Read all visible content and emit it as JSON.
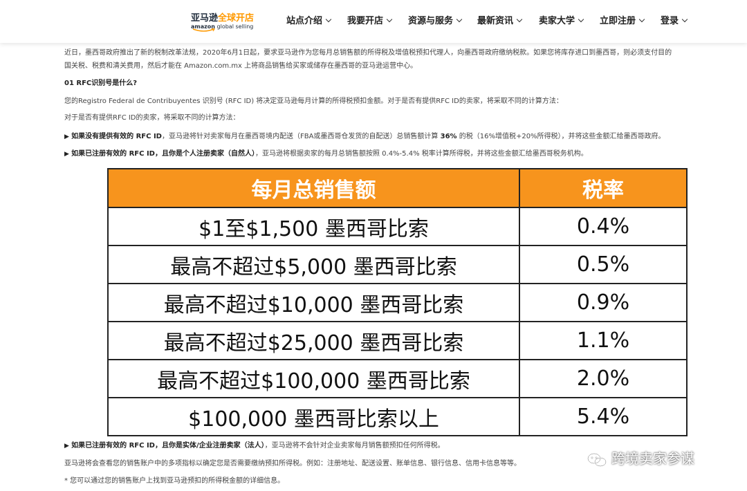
{
  "logo": {
    "cn_main": "亚马逊",
    "cn_accent": "全球开店",
    "brand": "amazon",
    "sub": "global selling"
  },
  "nav": {
    "items": [
      {
        "label": "站点介绍"
      },
      {
        "label": "我要开店"
      },
      {
        "label": "资源与服务"
      },
      {
        "label": "最新资讯"
      },
      {
        "label": "卖家大学"
      },
      {
        "label": "立即注册"
      },
      {
        "label": "登录"
      }
    ]
  },
  "article": {
    "intro_line1": "近日，墨西哥政府推出了新的税制改革法规，2020年6月1日起，要求亚马逊作为您每月总销售额的所得税及增值税预扣代理人，向墨西哥政府缴纳税款。如果您将库存进口到墨西哥，则必须支付目的",
    "intro_line2": "国关税、税费和清关费用，然后才能在 Amazon.com.mx 上将商品销售给买家或储存在墨西哥的亚马逊运营中心。",
    "heading": "01 RFC识别号是什么?",
    "rfc_desc": "您的Registro Federal de Contribuyentes 识别号 (RFC ID) 将决定亚马逊每月计算的所得税预扣金额。对于是否有提供RFC ID的卖家，将采取不同的计算方法：",
    "rfc_desc2": "对于是否有提供RFC ID的卖家，将采取不同的计算方法：",
    "bullet1_bold": "如果没有提供有效的 RFC ID",
    "bullet1_mid": "，亚马逊将针对卖家每月在墨西哥境内配送（FBA或墨西哥仓发货的自配送）总销售额计算 ",
    "bullet1_bold2": "36%",
    "bullet1_end": " 的税（16%增值税+20%所得税），并将这些金额汇给墨西哥政府。",
    "bullet2_bold": "如果已注册有效的 RFC ID，且你是个人注册卖家（自然人）",
    "bullet2_end": "，亚马逊将根据卖家的每月总销售额按照 0.4%-5.4% 税率计算所得税，并将这些金额汇给墨西哥税务机构。",
    "bullet3_bold": "如果已注册有效的 RFC ID，且你是实体/企业注册卖家（法人）",
    "bullet3_end": "，亚马逊将不会针对企业卖家每月销售额预扣任何所得税。",
    "review_line": "亚马逊将会查看您的销售账户中的多项指标以确定您是否需要缴纳预扣所得税。例如：注册地址、配送设置、账单信息、银行信息、信用卡信息等等。",
    "note_line": "* 您可以通过您的销售账户上找到亚马逊预扣的所得税金额的详细信息。",
    "bullet_marker": "▶"
  },
  "rate_table": {
    "headers": [
      "每月总销售额",
      "税率"
    ],
    "rows": [
      [
        "$1至$1,500 墨西哥比索",
        "0.4%"
      ],
      [
        "最高不超过$5,000 墨西哥比索",
        "0.5%"
      ],
      [
        "最高不超过$10,000 墨西哥比索",
        "0.9%"
      ],
      [
        "最高不超过$25,000 墨西哥比索",
        "1.1%"
      ],
      [
        "最高不超过$100,000 墨西哥比索",
        "2.0%"
      ],
      [
        "$100,000 墨西哥比索以上",
        "5.4%"
      ]
    ]
  },
  "watermark": {
    "text": "跨境卖家参谋",
    "icon": "wechat-icon"
  },
  "colors": {
    "header_orange": "#f7941d",
    "logo_orange": "#ff9900",
    "amazon_navy": "#232f3e"
  }
}
